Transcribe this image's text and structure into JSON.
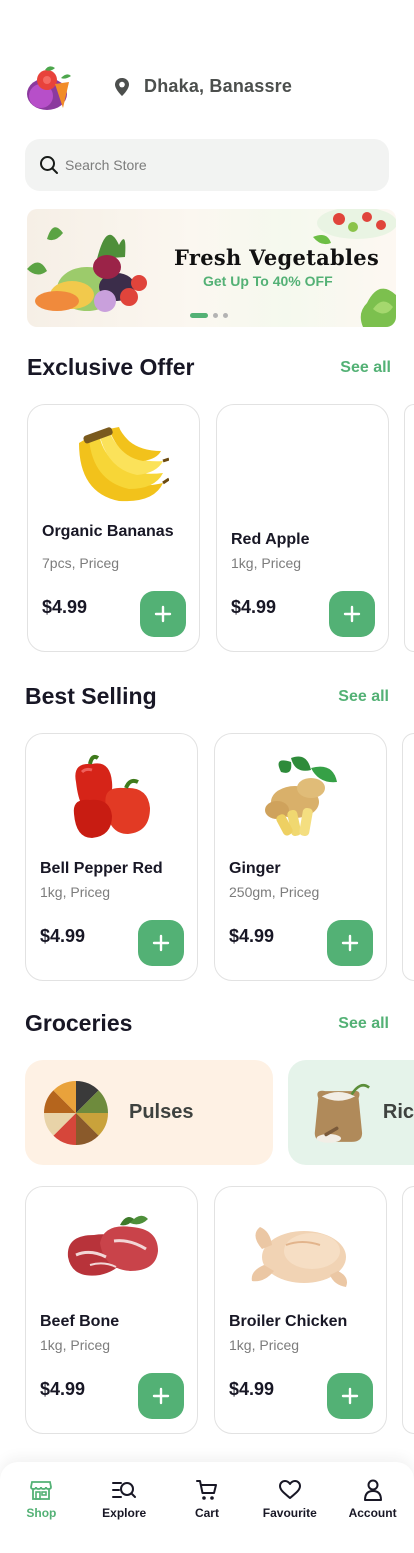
{
  "header": {
    "logo_icon": "fruit-logo-icon",
    "location_icon": "map-pin-icon",
    "location": "Dhaka, Banassre"
  },
  "search": {
    "placeholder": "Search Store"
  },
  "banner": {
    "title": "Fresh Vegetables",
    "subtitle": "Get Up To 40% OFF",
    "slide_count": 3,
    "active_slide": 1
  },
  "sections": {
    "exclusive": {
      "title": "Exclusive Offer",
      "see_all": "See all",
      "products": [
        {
          "name": "Organic Bananas",
          "meta": "7pcs, Priceg",
          "price": "$4.99",
          "image": "banana-image"
        },
        {
          "name": "Red Apple",
          "meta": "1kg, Priceg",
          "price": "$4.99",
          "image": "red-apple-image"
        }
      ]
    },
    "best_selling": {
      "title": "Best Selling",
      "see_all": "See all",
      "products": [
        {
          "name": "Bell Pepper Red",
          "meta": "1kg, Priceg",
          "price": "$4.99",
          "image": "bell-pepper-image"
        },
        {
          "name": "Ginger",
          "meta": "250gm, Priceg",
          "price": "$4.99",
          "image": "ginger-image"
        }
      ]
    },
    "groceries": {
      "title": "Groceries",
      "see_all": "See all",
      "categories": [
        {
          "label": "Pulses",
          "bg": "#FEF1E4",
          "image": "pulses-image"
        },
        {
          "label": "Ric",
          "bg": "#E5F3EA",
          "image": "rice-sack-image"
        }
      ],
      "products": [
        {
          "name": "Beef Bone",
          "meta": "1kg, Priceg",
          "price": "$4.99",
          "image": "beef-image"
        },
        {
          "name": "Broiler Chicken",
          "meta": "1kg, Priceg",
          "price": "$4.99",
          "image": "chicken-image"
        }
      ]
    }
  },
  "nav": {
    "items": [
      {
        "label": "Shop",
        "icon": "store-icon",
        "active": true
      },
      {
        "label": "Explore",
        "icon": "explore-icon",
        "active": false
      },
      {
        "label": "Cart",
        "icon": "cart-icon",
        "active": false
      },
      {
        "label": "Favourite",
        "icon": "heart-icon",
        "active": false
      },
      {
        "label": "Account",
        "icon": "user-icon",
        "active": false
      }
    ]
  },
  "colors": {
    "accent": "#53B175",
    "text": "#181725",
    "muted": "#7C7C7C",
    "card_border": "#E2E2E2",
    "search_bg": "#F2F3F2"
  }
}
